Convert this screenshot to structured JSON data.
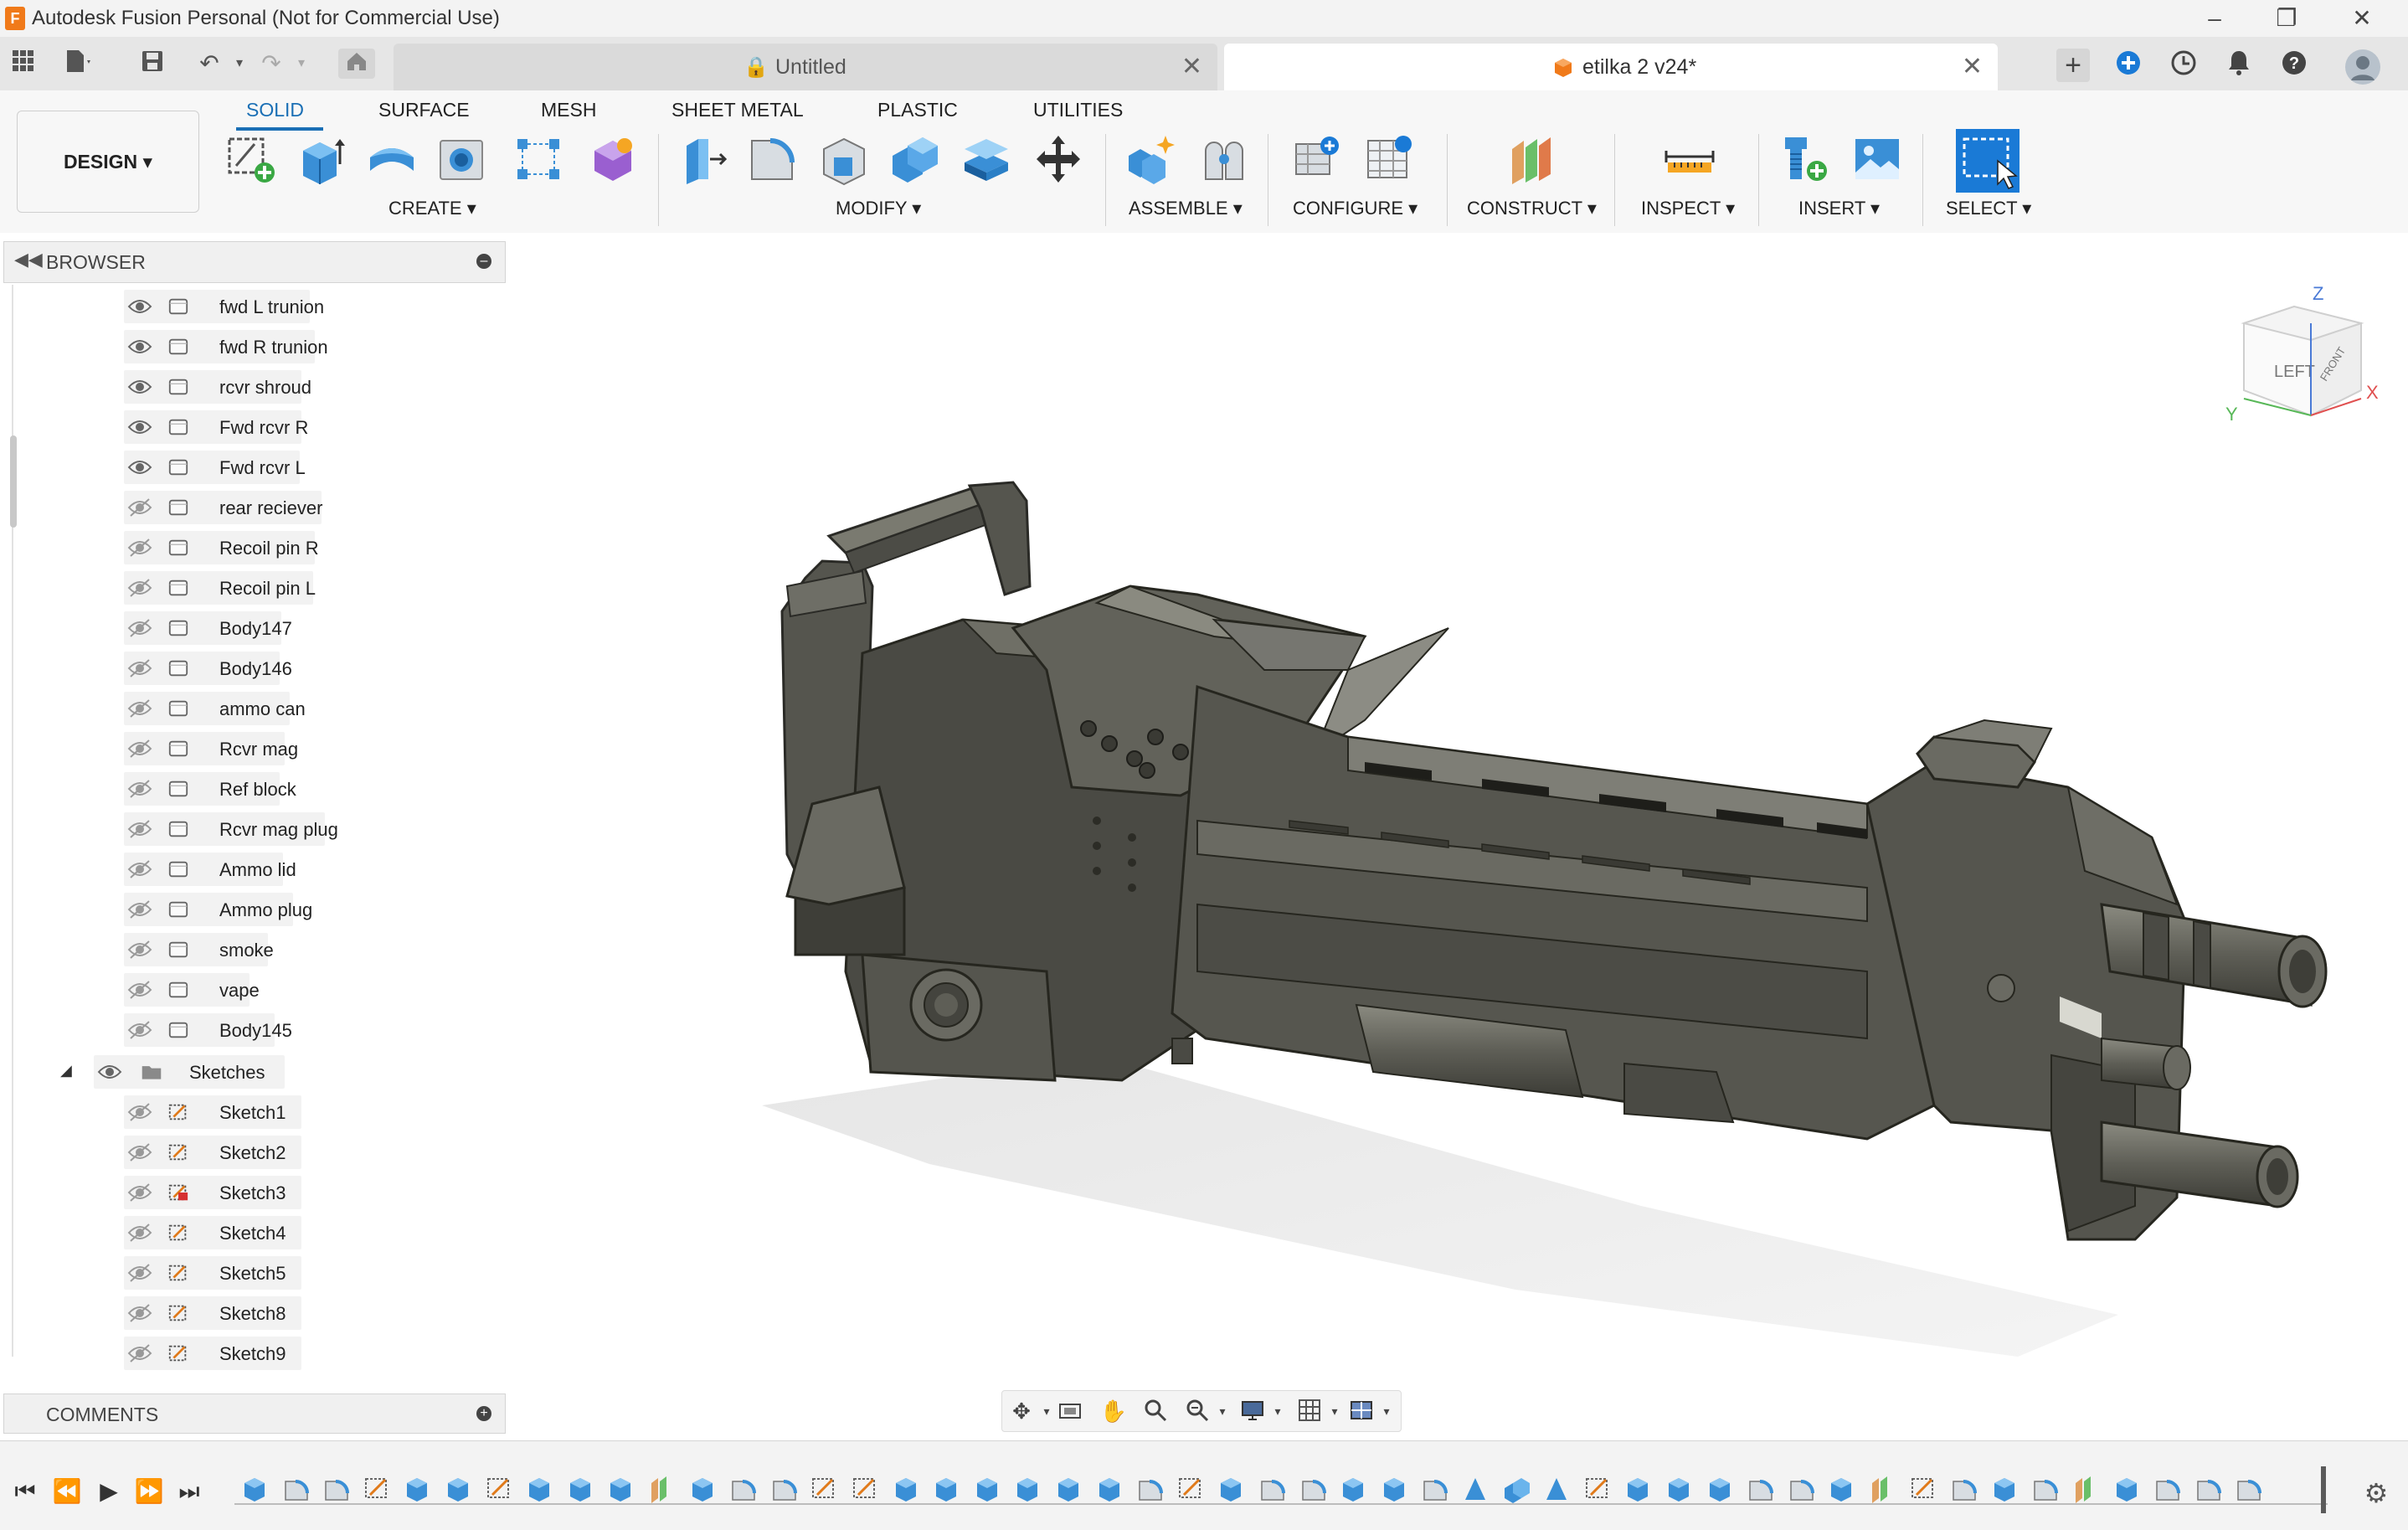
{
  "window": {
    "title": "Autodesk Fusion Personal (Not for Commercial Use)",
    "logo_text": "F"
  },
  "tabs": {
    "inactive_label": "Untitled",
    "active_label": "etilka 2 v24*"
  },
  "toolbar": {
    "workspace_button": "DESIGN ▾",
    "workspace_tabs": [
      "SOLID",
      "SURFACE",
      "MESH",
      "SHEET METAL",
      "PLASTIC",
      "UTILITIES"
    ],
    "groups": [
      "CREATE ▾",
      "MODIFY ▾",
      "ASSEMBLE ▾",
      "CONFIGURE ▾",
      "CONSTRUCT ▾",
      "INSPECT ▾",
      "INSERT ▾",
      "SELECT ▾"
    ]
  },
  "browser": {
    "title": "BROWSER",
    "bodies": [
      {
        "label": "fwd L trunion",
        "visible": true
      },
      {
        "label": "fwd R trunion",
        "visible": true
      },
      {
        "label": "rcvr shroud",
        "visible": true
      },
      {
        "label": "Fwd rcvr R",
        "visible": true
      },
      {
        "label": "Fwd rcvr L",
        "visible": true
      },
      {
        "label": "rear reciever",
        "visible": false
      },
      {
        "label": "Recoil pin R",
        "visible": false
      },
      {
        "label": "Recoil pin L",
        "visible": false
      },
      {
        "label": "Body147",
        "visible": false
      },
      {
        "label": "Body146",
        "visible": false
      },
      {
        "label": "ammo can",
        "visible": false
      },
      {
        "label": "Rcvr mag",
        "visible": false
      },
      {
        "label": "Ref block",
        "visible": false
      },
      {
        "label": "Rcvr mag plug",
        "visible": false
      },
      {
        "label": "Ammo lid",
        "visible": false
      },
      {
        "label": "Ammo plug",
        "visible": false
      },
      {
        "label": "smoke",
        "visible": false
      },
      {
        "label": "vape",
        "visible": false
      },
      {
        "label": "Body145",
        "visible": false
      }
    ],
    "sketches_folder": "Sketches",
    "sketches": [
      "Sketch1",
      "Sketch2",
      "Sketch3",
      "Sketch4",
      "Sketch5",
      "Sketch8",
      "Sketch9"
    ]
  },
  "viewcube": {
    "left_label": "LEFT",
    "front_label": "FRONT",
    "axis_z": "Z",
    "axis_x": "X",
    "axis_y": "Y"
  },
  "comments": {
    "title": "COMMENTS"
  },
  "colors": {
    "accent": "#1a6fb5",
    "model": "#5a5a52",
    "model_dark": "#3e3e38",
    "model_light": "#7c7c72"
  }
}
